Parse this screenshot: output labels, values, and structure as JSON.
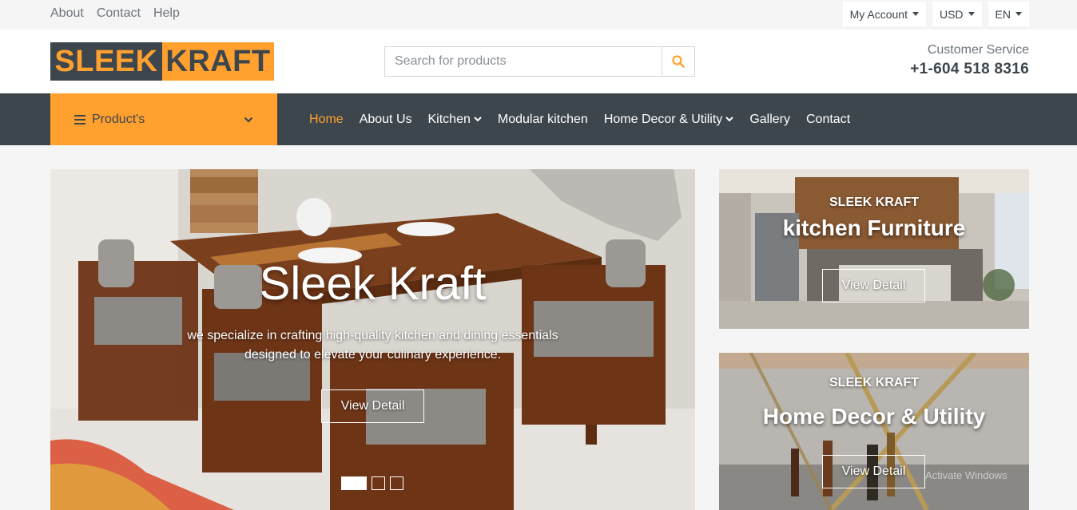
{
  "topbar": {
    "links": [
      "About",
      "Contact",
      "Help"
    ],
    "dropdowns": [
      "My Account",
      "USD",
      "EN"
    ]
  },
  "header": {
    "logo": {
      "part1": "SLEEK",
      "part2": "KRAFT"
    },
    "search_placeholder": "Search for products",
    "customer_service_label": "Customer Service",
    "phone": "+1-604 518 8316"
  },
  "nav": {
    "category_button": "Product's",
    "links": [
      {
        "label": "Home",
        "active": true
      },
      {
        "label": "About Us"
      },
      {
        "label": "Kitchen",
        "dropdown": true
      },
      {
        "label": "Modular kitchen"
      },
      {
        "label": "Home Decor & Utility",
        "dropdown": true
      },
      {
        "label": "Gallery"
      },
      {
        "label": "Contact"
      }
    ]
  },
  "carousel": {
    "title": "Sleek Kraft",
    "description_line1": "we specialize in crafting high-quality kitchen and dining essentials",
    "description_line2": "designed to elevate your culinary experience.",
    "button": "View Detail",
    "slides": 3,
    "active_slide": 1
  },
  "offers": [
    {
      "brand": "SLEEK KRAFT",
      "title": "kitchen Furniture",
      "button": "View Detail"
    },
    {
      "brand": "SLEEK KRAFT",
      "title": "Home Decor & Utility",
      "button": "View Detail"
    }
  ],
  "watermark": "Activate Windows",
  "colors": {
    "accent": "#ffa02f",
    "dark": "#3d464d",
    "light_bg": "#f5f5f5"
  },
  "icons": [
    "search-icon",
    "menu-icon",
    "chevron-down-icon",
    "caret-down-icon"
  ]
}
